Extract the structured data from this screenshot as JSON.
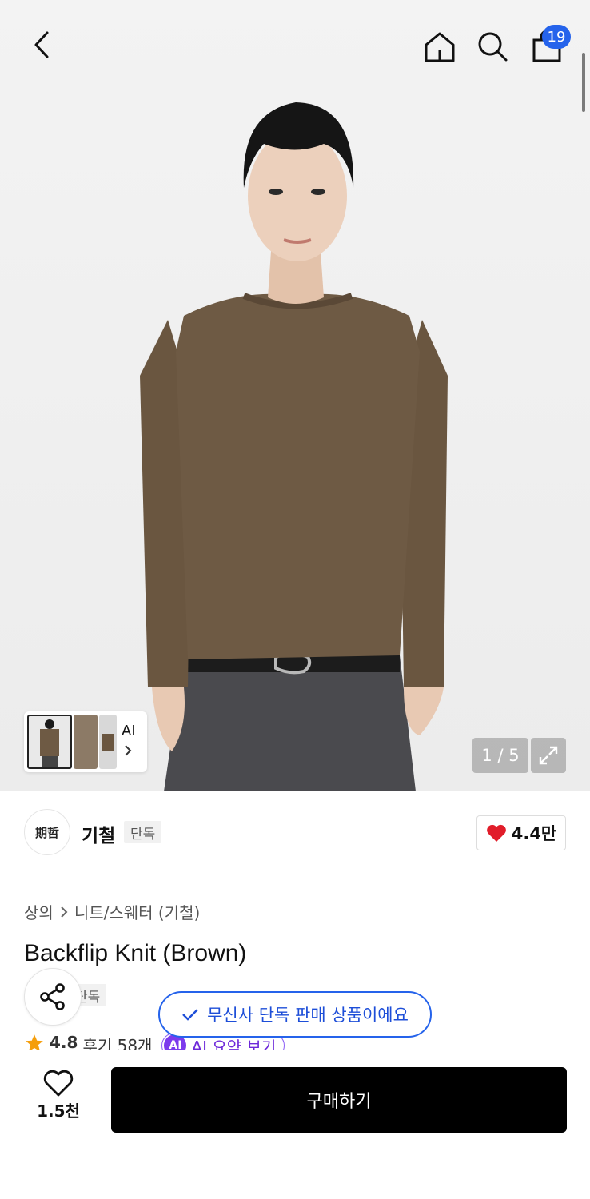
{
  "header": {
    "cart_count": "19"
  },
  "gallery": {
    "counter": "1 / 5",
    "ai_label": "AI"
  },
  "brand": {
    "logo_text": "期哲",
    "name": "기철",
    "tag": "단독",
    "likes": "4.4만"
  },
  "product": {
    "breadcrumb": [
      "상의",
      "니트/스웨터 (기철)"
    ],
    "title": "Backflip Knit (Brown)",
    "sub_tag": "단독",
    "rating": "4.8",
    "reviews": "후기 58개",
    "ai_badge": "AI",
    "ai_summary": "AI 요약 보기"
  },
  "toast": {
    "text": "무신사 단독 판매 상품이에요"
  },
  "bottom": {
    "wish_count": "1.5천",
    "buy_label": "구매하기"
  },
  "colors": {
    "accent": "#2563eb",
    "ai_purple": "#7c3aed",
    "sweater": "#6e5a44",
    "heart": "#e11d2a"
  }
}
